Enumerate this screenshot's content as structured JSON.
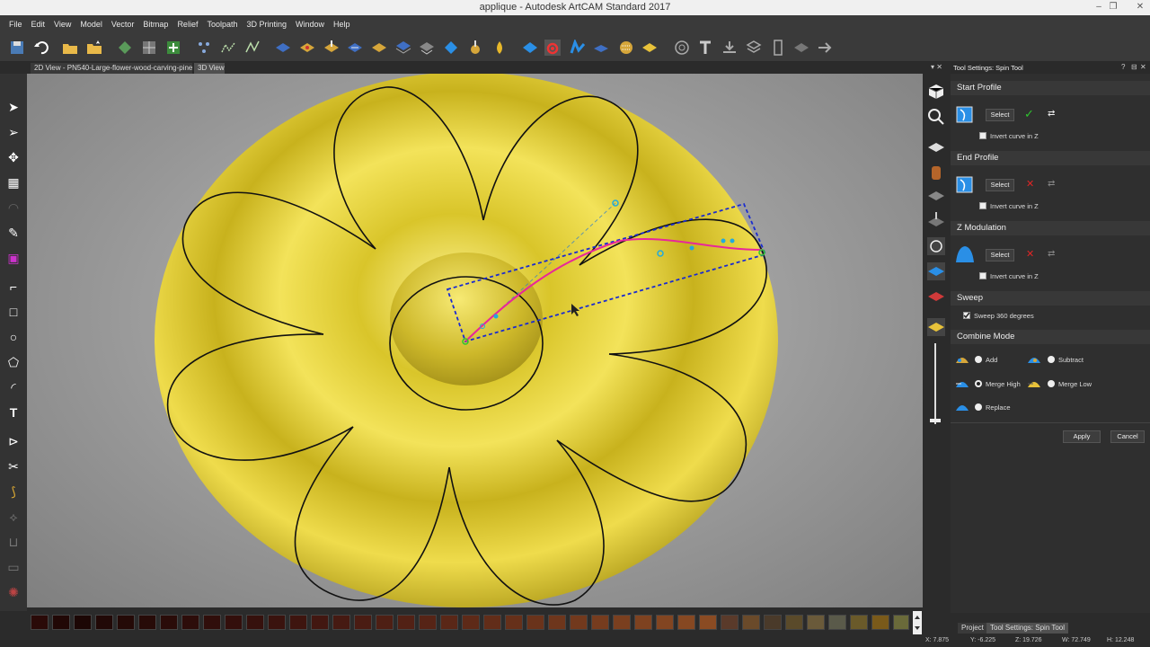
{
  "window": {
    "title": "applique - Autodesk ArtCAM Standard 2017"
  },
  "menu": [
    "File",
    "Edit",
    "View",
    "Model",
    "Vector",
    "Bitmap",
    "Relief",
    "Toolpath",
    "3D Printing",
    "Window",
    "Help"
  ],
  "toolbar_icons": [
    "save-icon",
    "undo-icon",
    "open-folder-icon",
    "new-folder-icon",
    "relief-icon",
    "grid-icon",
    "add-icon",
    "node-icon",
    "bitmap-icon",
    "vector-icon",
    "shape-icon",
    "extrude-icon",
    "sweep-icon",
    "spin-icon",
    "layer-icon",
    "combine-icon",
    "smooth-icon",
    "diamond-icon",
    "sculpt-icon",
    "drop-icon",
    "blue-diamond-icon",
    "spin-tool-icon",
    "wave-icon",
    "flat-icon",
    "texture-icon",
    "gold-icon",
    "target-icon",
    "text-icon",
    "import-icon",
    "stack-icon",
    "ruler-icon",
    "fade-icon",
    "arrow-icon"
  ],
  "view_tabs": [
    "2D View - PN540-Large-flower-wood-carving-pine",
    "3D View"
  ],
  "panel": {
    "title": "Tool Settings: Spin Tool",
    "start_profile": {
      "heading": "Start Profile",
      "select": "Select",
      "invert": "Invert curve in Z"
    },
    "end_profile": {
      "heading": "End Profile",
      "select": "Select",
      "invert": "Invert curve in Z"
    },
    "z_modulation": {
      "heading": "Z Modulation",
      "select": "Select",
      "invert": "Invert curve in Z"
    },
    "sweep": {
      "heading": "Sweep",
      "option": "Sweep 360 degrees"
    },
    "combine": {
      "heading": "Combine Mode",
      "add": "Add",
      "subtract": "Subtract",
      "merge_high": "Merge High",
      "merge_low": "Merge Low",
      "replace": "Replace",
      "selected": "Merge High"
    },
    "apply": "Apply",
    "cancel": "Cancel"
  },
  "bottom_tabs": [
    "Project",
    "Tool Settings: Spin Tool"
  ],
  "status": {
    "x": "X: 7.875",
    "y": "Y: -6.225",
    "z": "Z: 19.726",
    "w": "W: 72.749",
    "h": "H: 12.248"
  },
  "colors": {
    "relief_yellow": "#e3d230",
    "curve_magenta": "#e8279a",
    "box_blue": "#1a2bd0",
    "accent_green": "#2fc42f",
    "accent_red": "#e02525"
  }
}
